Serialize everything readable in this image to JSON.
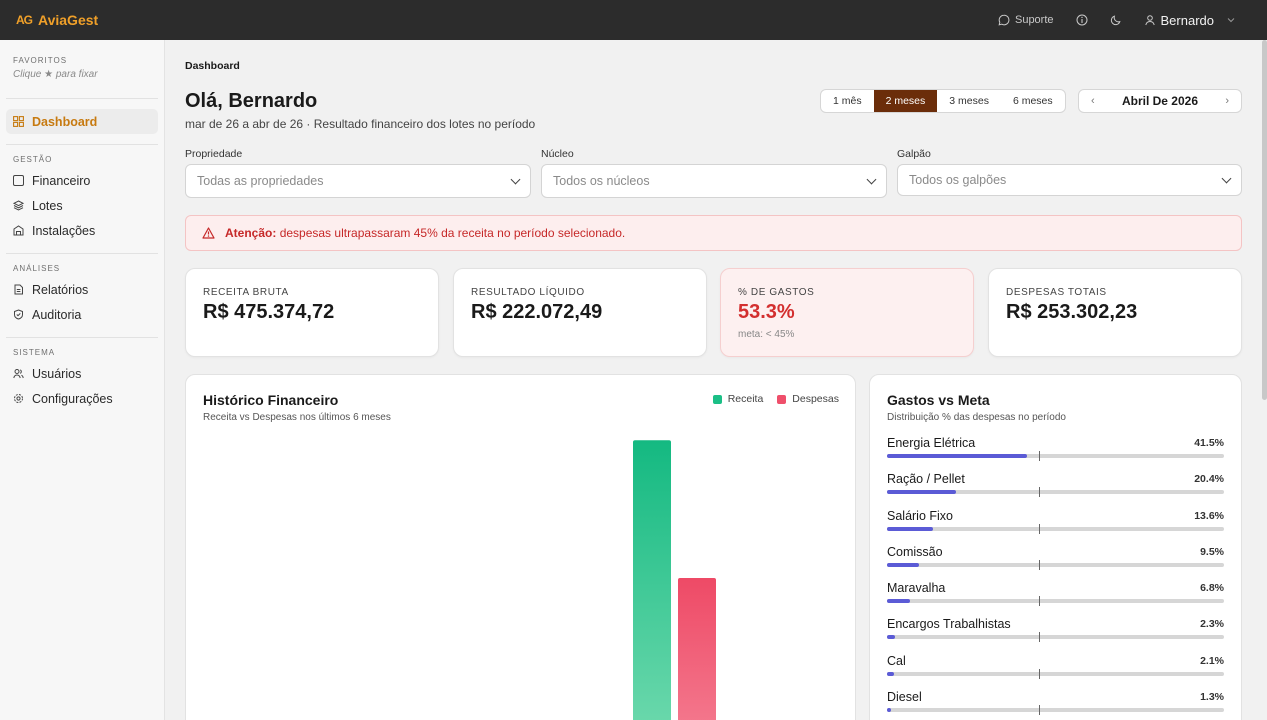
{
  "app": {
    "name": "AviaGest",
    "logo_text": "AG"
  },
  "topbar": {
    "support_label": "Suporte",
    "user_name": "Bernardo"
  },
  "sidebar": {
    "favorites_title": "FAVORITOS",
    "favorites_hint": "Clique ★ para fixar",
    "dashboard_label": "Dashboard",
    "gestao_title": "GESTÃO",
    "gestao_items": [
      "Financeiro",
      "Lotes",
      "Instalações"
    ],
    "analises_title": "ANÁLISES",
    "analises_items": [
      "Relatórios",
      "Auditoria"
    ],
    "sistema_title": "SISTEMA",
    "sistema_items": [
      "Usuários",
      "Configurações"
    ]
  },
  "header": {
    "breadcrumb": "Dashboard",
    "greeting": "Olá, Bernardo",
    "subtitle": "mar de 26 a abr de 26 · Resultado financeiro dos lotes no período",
    "periods": [
      "1 mês",
      "2 meses",
      "3 meses",
      "6 meses"
    ],
    "active_period": "2 meses",
    "month": "Abril De 2026"
  },
  "filters": {
    "propriedade": {
      "label": "Propriedade",
      "placeholder": "Todas as propriedades"
    },
    "nucleo": {
      "label": "Núcleo",
      "placeholder": "Todos os núcleos"
    },
    "galpao": {
      "label": "Galpão",
      "placeholder": "Todos os galpões"
    }
  },
  "alert": {
    "strong": "Atenção:",
    "text": "despesas ultrapassaram 45% da receita no período selecionado."
  },
  "kpis": {
    "receita": {
      "label": "RECEITA BRUTA",
      "value": "R$ 475.374,72"
    },
    "resultado": {
      "label": "RESULTADO LÍQUIDO",
      "value": "R$ 222.072,49"
    },
    "gastos": {
      "label": "% DE GASTOS",
      "value": "53.3%",
      "meta": "meta: < 45%"
    },
    "despesas": {
      "label": "DESPESAS TOTAIS",
      "value": "R$ 253.302,23"
    }
  },
  "historico": {
    "title": "Histórico Financeiro",
    "subtitle": "Receita vs Despesas nos últimos 6 meses",
    "legend_receita": "Receita",
    "legend_despesas": "Despesas"
  },
  "chart_data": {
    "type": "bar",
    "series": [
      {
        "name": "Receita",
        "color": "#1bbf86"
      },
      {
        "name": "Despesas",
        "color": "#ef4f6b"
      }
    ],
    "visible_bars": [
      {
        "series": "Receita",
        "value": 475374.72
      },
      {
        "series": "Despesas",
        "value": 253302.23
      }
    ]
  },
  "gastos_meta": {
    "title": "Gastos vs Meta",
    "subtitle": "Distribuição % das despesas no período",
    "target_pct": 45,
    "items": [
      {
        "name": "Energia Elétrica",
        "pct_label": "41.5%",
        "pct": 41.5
      },
      {
        "name": "Ração / Pellet",
        "pct_label": "20.4%",
        "pct": 20.4
      },
      {
        "name": "Salário Fixo",
        "pct_label": "13.6%",
        "pct": 13.6
      },
      {
        "name": "Comissão",
        "pct_label": "9.5%",
        "pct": 9.5
      },
      {
        "name": "Maravalha",
        "pct_label": "6.8%",
        "pct": 6.8
      },
      {
        "name": "Encargos Trabalhistas",
        "pct_label": "2.3%",
        "pct": 2.3
      },
      {
        "name": "Cal",
        "pct_label": "2.1%",
        "pct": 2.1
      },
      {
        "name": "Diesel",
        "pct_label": "1.3%",
        "pct": 1.3
      }
    ]
  }
}
